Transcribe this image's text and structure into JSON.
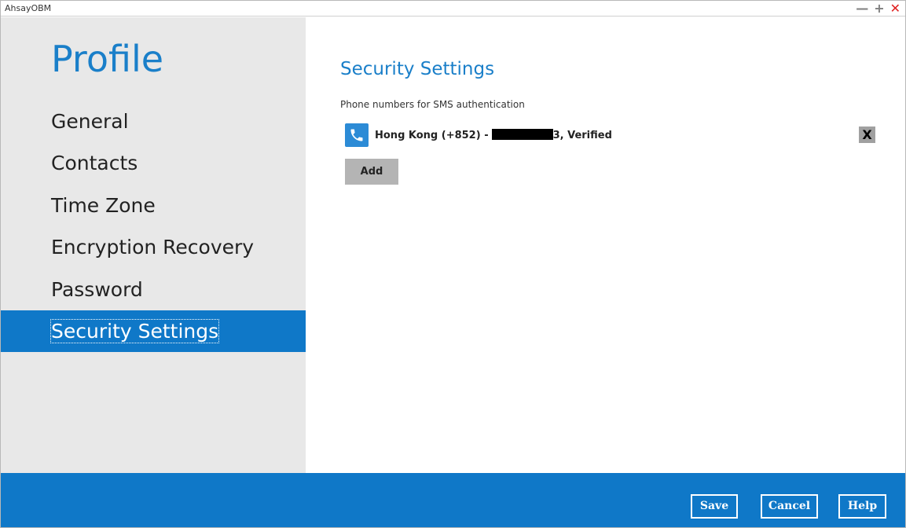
{
  "window": {
    "title": "AhsayOBM",
    "controls": {
      "minimize": "—",
      "maximize": "+",
      "close": "✕"
    }
  },
  "sidebar": {
    "heading": "Profile",
    "items": [
      {
        "label": "General"
      },
      {
        "label": "Contacts"
      },
      {
        "label": "Time Zone"
      },
      {
        "label": "Encryption Recovery"
      },
      {
        "label": "Password"
      },
      {
        "label": "Security Settings",
        "active": true
      }
    ]
  },
  "main": {
    "title": "Security Settings",
    "subtitle": "Phone numbers for SMS authentication",
    "phone": {
      "icon": "phone-icon",
      "prefix": "Hong Kong (+852) -",
      "suffix": "3, Verified",
      "remove_label": "X"
    },
    "add_label": "Add"
  },
  "footer": {
    "save_label": "Save",
    "cancel_label": "Cancel",
    "help_label": "Help"
  },
  "colors": {
    "accent": "#0f78c8",
    "heading": "#1a7fc9",
    "sidebar_bg": "#e8e8e8",
    "close": "#e02020"
  }
}
